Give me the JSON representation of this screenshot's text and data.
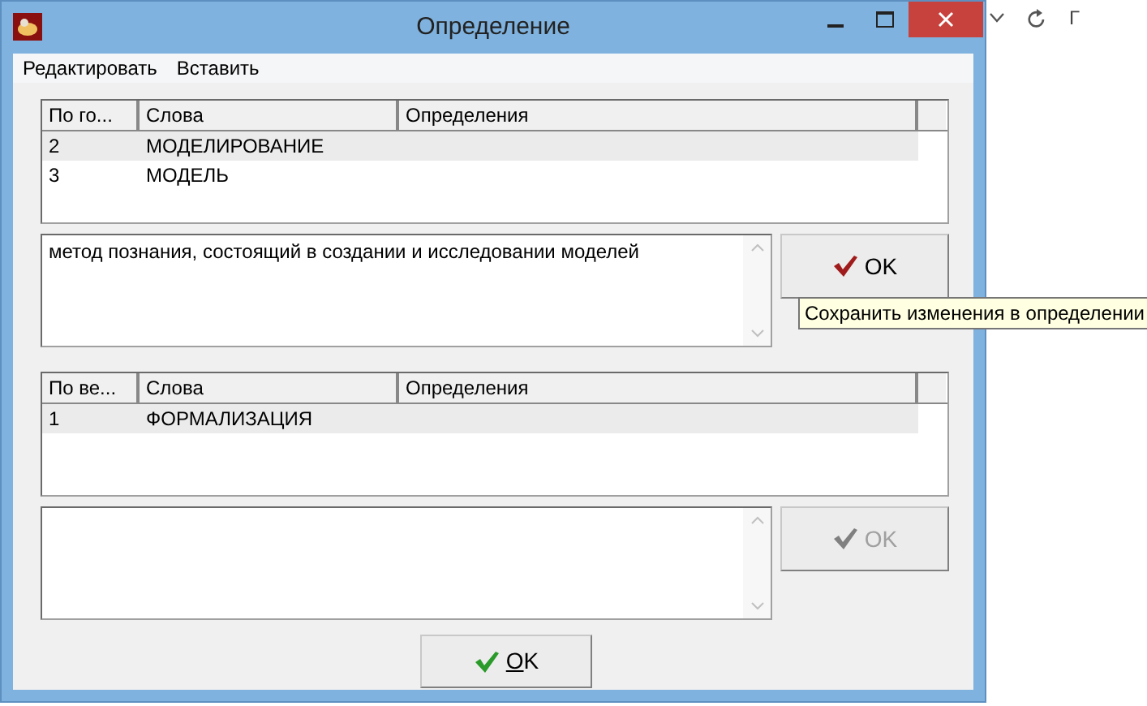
{
  "window": {
    "title": "Определение"
  },
  "menu": [
    {
      "label": "Редактировать"
    },
    {
      "label": "Вставить"
    }
  ],
  "panels": [
    {
      "table": {
        "columns": [
          "По го...",
          "Слова",
          "Определения"
        ],
        "rows": [
          {
            "cells": [
              "2",
              "МОДЕЛИРОВАНИЕ"
            ],
            "selected": true
          },
          {
            "cells": [
              "3",
              "МОДЕЛЬ"
            ],
            "selected": false
          }
        ]
      },
      "definition": {
        "value": "метод познания, состоящий в создании и исследовании моделей"
      },
      "button": {
        "label": "OK",
        "disabled": false,
        "color": "#a01c1c"
      }
    },
    {
      "table": {
        "columns": [
          "По ве...",
          "Слова",
          "Определения"
        ],
        "rows": [
          {
            "cells": [
              "1",
              "ФОРМАЛИЗАЦИЯ"
            ],
            "selected": true
          }
        ]
      },
      "button": {
        "label": "OK",
        "disabled": true,
        "color": "#808080"
      }
    }
  ],
  "tooltip": "Сохранить изменения в определении",
  "ok_button": {
    "label": "OK",
    "underlined_first": true,
    "color": "#2a9a2a"
  },
  "browser": {
    "text": "Г"
  }
}
